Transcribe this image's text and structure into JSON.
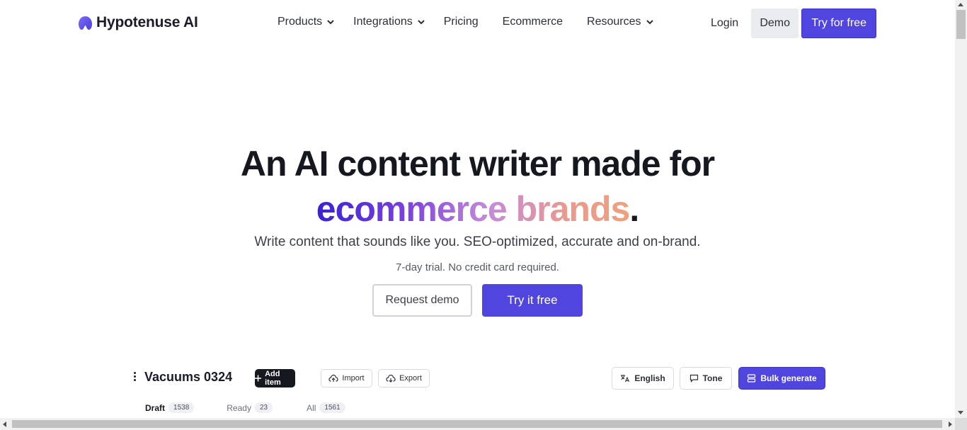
{
  "nav": {
    "brand": "Hypotenuse AI",
    "links": [
      {
        "label": "Products",
        "has_dropdown": true
      },
      {
        "label": "Integrations",
        "has_dropdown": true
      },
      {
        "label": "Pricing",
        "has_dropdown": false
      },
      {
        "label": "Ecommerce",
        "has_dropdown": false
      },
      {
        "label": "Resources",
        "has_dropdown": true
      }
    ],
    "login": "Login",
    "demo": "Demo",
    "try_free": "Try for free"
  },
  "hero": {
    "title_line1": "An AI content writer made for",
    "title_line2_gradient": "ecommerce brands",
    "title_line2_end": ".",
    "subtitle": "Write content that sounds like you. SEO-optimized, accurate and on-brand.",
    "note": "7-day trial. No credit card required.",
    "request_demo": "Request demo",
    "try_it_free": "Try it free"
  },
  "preview": {
    "title": "Vacuums 0324",
    "add_item": "Add item",
    "import": "Import",
    "export": "Export",
    "language": "English",
    "tone": "Tone",
    "bulk_generate": "Bulk generate",
    "tabs": [
      {
        "label": "Draft",
        "count": "1538",
        "active": true
      },
      {
        "label": "Ready",
        "count": "23",
        "active": false
      },
      {
        "label": "All",
        "count": "1561",
        "active": false
      }
    ]
  },
  "colors": {
    "brand_primary": "#5145e0",
    "text_dark": "#15181f",
    "gradient": [
      "#3a22d6",
      "#7a3fe0",
      "#c68ad9",
      "#e99a8e",
      "#f0a07a"
    ]
  }
}
